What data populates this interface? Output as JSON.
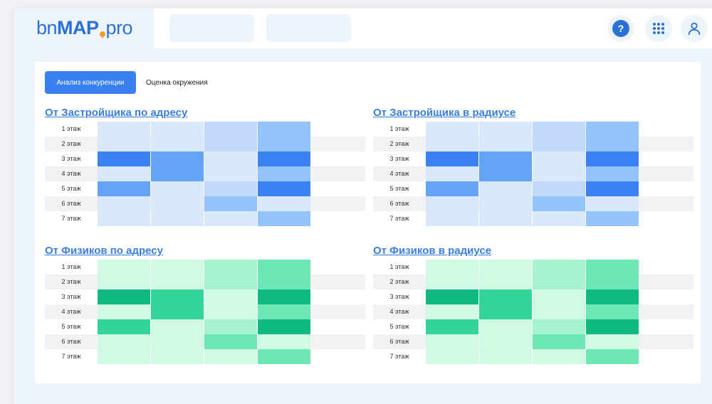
{
  "header": {
    "logo": {
      "part1": "bn",
      "part2": "MAP",
      "part3": "pro"
    },
    "help_label": "?"
  },
  "tabs": [
    {
      "label": "Анализ конкуренции",
      "active": true
    },
    {
      "label": "Оценка окружения",
      "active": false
    }
  ],
  "colors": {
    "accent": "#3a80f0",
    "blue_scale": [
      "#dae8fc",
      "#c1dafc",
      "#93c3fb",
      "#64a4f6",
      "#3b82f3"
    ],
    "green_scale": [
      "#d1fae5",
      "#a7f3d0",
      "#6ee7b7",
      "#34d399",
      "#10b981"
    ]
  },
  "sections": [
    {
      "title": "От Застройщика по адресу",
      "palette": "blue",
      "rows": [
        {
          "label": "1 этаж",
          "levels": [
            0,
            0,
            1,
            2
          ]
        },
        {
          "label": "2 этаж",
          "levels": [
            0,
            0,
            1,
            2
          ]
        },
        {
          "label": "3 этаж",
          "levels": [
            4,
            3,
            0,
            4
          ]
        },
        {
          "label": "4 этаж",
          "levels": [
            0,
            3,
            0,
            2
          ]
        },
        {
          "label": "5 этаж",
          "levels": [
            3,
            0,
            1,
            4
          ]
        },
        {
          "label": "6 этаж",
          "levels": [
            0,
            0,
            2,
            0
          ]
        },
        {
          "label": "7 этаж",
          "levels": [
            0,
            0,
            0,
            2
          ]
        }
      ]
    },
    {
      "title": "От Застройщика в радиусе",
      "palette": "blue",
      "rows": [
        {
          "label": "1 этаж",
          "levels": [
            0,
            0,
            1,
            2
          ]
        },
        {
          "label": "2 этаж",
          "levels": [
            0,
            0,
            1,
            2
          ]
        },
        {
          "label": "3 этаж",
          "levels": [
            4,
            3,
            0,
            4
          ]
        },
        {
          "label": "4 этаж",
          "levels": [
            0,
            3,
            0,
            2
          ]
        },
        {
          "label": "5 этаж",
          "levels": [
            3,
            0,
            1,
            4
          ]
        },
        {
          "label": "6 этаж",
          "levels": [
            0,
            0,
            2,
            0
          ]
        },
        {
          "label": "7 этаж",
          "levels": [
            0,
            0,
            0,
            2
          ]
        }
      ]
    },
    {
      "title": "От Физиков по адресу",
      "palette": "green",
      "rows": [
        {
          "label": "1 этаж",
          "levels": [
            0,
            0,
            1,
            2
          ]
        },
        {
          "label": "2 этаж",
          "levels": [
            0,
            0,
            1,
            2
          ]
        },
        {
          "label": "3 этаж",
          "levels": [
            4,
            3,
            0,
            4
          ]
        },
        {
          "label": "4 этаж",
          "levels": [
            0,
            3,
            0,
            2
          ]
        },
        {
          "label": "5 этаж",
          "levels": [
            3,
            0,
            1,
            4
          ]
        },
        {
          "label": "6 этаж",
          "levels": [
            0,
            0,
            2,
            0
          ]
        },
        {
          "label": "7 этаж",
          "levels": [
            0,
            0,
            0,
            2
          ]
        }
      ]
    },
    {
      "title": "От Физиков в радиусе",
      "palette": "green",
      "rows": [
        {
          "label": "1 этаж",
          "levels": [
            0,
            0,
            1,
            2
          ]
        },
        {
          "label": "2 этаж",
          "levels": [
            0,
            0,
            1,
            2
          ]
        },
        {
          "label": "3 этаж",
          "levels": [
            4,
            3,
            0,
            4
          ]
        },
        {
          "label": "4 этаж",
          "levels": [
            0,
            3,
            0,
            2
          ]
        },
        {
          "label": "5 этаж",
          "levels": [
            3,
            0,
            1,
            4
          ]
        },
        {
          "label": "6 этаж",
          "levels": [
            0,
            0,
            2,
            0
          ]
        },
        {
          "label": "7 этаж",
          "levels": [
            0,
            0,
            0,
            2
          ]
        }
      ]
    }
  ]
}
